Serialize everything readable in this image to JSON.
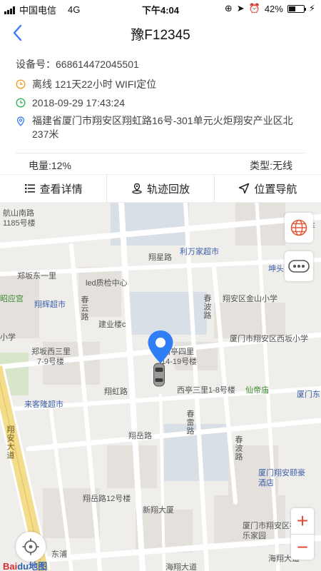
{
  "status_bar": {
    "carrier": "中国电信",
    "network": "4G",
    "time": "下午4:04",
    "battery": "42%",
    "battery_level": 0.42
  },
  "nav": {
    "title": "豫F12345"
  },
  "device": {
    "id_label": "设备号：",
    "id": "668614472045501",
    "status": "离线 121天22小时 WIFI定位",
    "timestamp": "2018-09-29 17:43:24",
    "address": "福建省厦门市翔安区翔虹路16号-301单元火炬翔安产业区北237米"
  },
  "stats": {
    "battery": "电量:12%",
    "type": "类型:无线"
  },
  "actions": [
    {
      "label": "查看详情",
      "icon": "list-icon"
    },
    {
      "label": "轨迹回放",
      "icon": "track-icon"
    },
    {
      "label": "位置导航",
      "icon": "navigate-icon"
    }
  ],
  "map": {
    "labels": {
      "hangshan_road": "航山南路",
      "no1185": "1185号楼",
      "xiangxing_road": "翔星路",
      "lifangjia": "利万家超市",
      "kuntou": "坤头",
      "qiche": "汽车",
      "zhengban_east1": "郑坂东一里",
      "led_center": "led质检中心",
      "zhaoyin": "昭应宫",
      "xianghui": "翔辉超市",
      "chunyun_road": "春云路",
      "jianye": "建业楼c",
      "chunbo_road": "春波路",
      "jinshan_school": "翔安区金山小学",
      "xiao_xue": "小学",
      "xiting_school": "厦门市翔安区西坂小学",
      "zhengban_west3": "郑坂西三里",
      "no7_9": "7-9号楼",
      "xiting4": "西亭四里",
      "no14_19": "14-19号楼",
      "xianghong_road": "翔虹路",
      "xiting3": "西亭三里1-8号楼",
      "xiandi": "仙帝庙",
      "xiamen_right": "厦门东",
      "laikelong": "来客隆超市",
      "xiangan_avenue": "翔安大道",
      "chunlei_road": "春雷路",
      "xiangyue_road": "翔岳路",
      "chunbo_road2": "春波路",
      "yihao": "厦门翔安颐豪酒店",
      "no12": "翔岳路12号楼",
      "xinxiang": "新翔大厦",
      "fule": "厦门市翔安区福乐家园",
      "dongpu": "东浦",
      "haixiang_avenue": "海翔大道",
      "haixiang_avenue2": "海翔大道"
    },
    "logo_bai": "Bai",
    "logo_du": "du",
    "logo_map": "地图",
    "zoom_in": "+",
    "zoom_out": "−"
  },
  "colors": {
    "accent": "#3b7bf6",
    "road": "#ffffff",
    "block": "#e4e1dc",
    "green_block": "#d7e5c8",
    "blue_block": "#d9dfe7",
    "map_bg": "#f0eeeb",
    "zoom": "#e04a3a",
    "marker": "#2f7ef5",
    "highway": "#f3dc8b"
  }
}
